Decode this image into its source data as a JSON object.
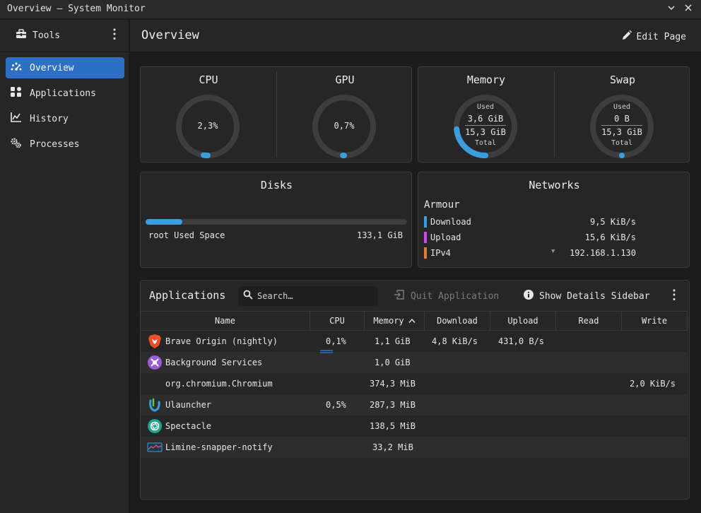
{
  "window": {
    "title": "Overview — System Monitor"
  },
  "sidebar": {
    "tools_label": "Tools",
    "items": [
      {
        "label": "Overview",
        "icon": "speedometer-icon",
        "active": true
      },
      {
        "label": "Applications",
        "icon": "grid-icon",
        "active": false
      },
      {
        "label": "History",
        "icon": "chart-icon",
        "active": false
      },
      {
        "label": "Processes",
        "icon": "gears-icon",
        "active": false
      }
    ]
  },
  "header": {
    "title": "Overview",
    "edit_label": "Edit Page"
  },
  "cpu": {
    "title": "CPU",
    "value": "2,3%",
    "fraction": 0.023
  },
  "gpu": {
    "title": "GPU",
    "value": "0,7%",
    "fraction": 0.007
  },
  "memory": {
    "title": "Memory",
    "used_label": "Used",
    "used": "3,6 GiB",
    "total": "15,3 GiB",
    "total_label": "Total",
    "fraction": 0.235
  },
  "swap": {
    "title": "Swap",
    "used_label": "Used",
    "used": "0 B",
    "total": "15,3 GiB",
    "total_label": "Total",
    "fraction": 0.0
  },
  "disks": {
    "title": "Disks",
    "label": "root Used Space",
    "value": "133,1 GiB",
    "fraction": 0.14
  },
  "networks": {
    "title": "Networks",
    "interface": "Armour",
    "rows": [
      {
        "label": "Download",
        "value": "9,5 KiB/s",
        "color": "#3d9ddc"
      },
      {
        "label": "Upload",
        "value": "15,6 KiB/s",
        "color": "#c44fd8"
      },
      {
        "label": "IPv4",
        "value": "192.168.1.130",
        "color": "#e07b39"
      }
    ]
  },
  "applications": {
    "title": "Applications",
    "search_placeholder": "Search…",
    "quit_label": "Quit Application",
    "details_label": "Show Details Sidebar",
    "columns": [
      "Name",
      "CPU",
      "Memory",
      "Download",
      "Upload",
      "Read",
      "Write"
    ],
    "rows": [
      {
        "name": "Brave Origin (nightly)",
        "icon": "brave-lion-icon",
        "cpu": "0,1%",
        "memory": "1,1 GiB",
        "download": "4,8 KiB/s",
        "upload": "431,0 B/s",
        "read": "",
        "write": ""
      },
      {
        "name": "Background Services",
        "icon": "services-cog-icon",
        "cpu": "",
        "memory": "1,0 GiB",
        "download": "",
        "upload": "",
        "read": "",
        "write": ""
      },
      {
        "name": "org.chromium.Chromium",
        "icon": "",
        "cpu": "",
        "memory": "374,3 MiB",
        "download": "",
        "upload": "",
        "read": "",
        "write": "2,0 KiB/s"
      },
      {
        "name": "Ulauncher",
        "icon": "ulauncher-icon",
        "cpu": "0,5%",
        "memory": "287,3 MiB",
        "download": "",
        "upload": "",
        "read": "",
        "write": ""
      },
      {
        "name": "Spectacle",
        "icon": "spectacle-aperture-icon",
        "cpu": "",
        "memory": "138,5 MiB",
        "download": "",
        "upload": "",
        "read": "",
        "write": ""
      },
      {
        "name": "Limine-snapper-notify",
        "icon": "snapper-chart-icon",
        "cpu": "",
        "memory": "33,2 MiB",
        "download": "",
        "upload": "",
        "read": "",
        "write": ""
      }
    ]
  },
  "colors": {
    "accent": "#2c6fc4",
    "gauge": "#3d9ddc",
    "gauge_track": "#3d3d3e"
  }
}
